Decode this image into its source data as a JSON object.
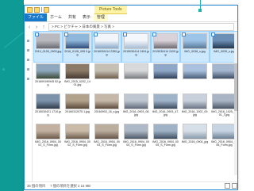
{
  "window": {
    "tools_badge": "Picture Tools",
    "title": "img"
  },
  "ribbon": {
    "tabs": [
      "ファイル",
      "ホーム",
      "共有",
      "表示",
      "管理"
    ]
  },
  "address": {
    "path": "> PC > ピクチャ > 日本の風景 > 写真 >"
  },
  "files": [
    {
      "name": "2019_0128_0903.jpg",
      "colors": [
        "#b9b9c0",
        "#6a6a72"
      ],
      "selected": true
    },
    {
      "name": "2016_0128_095 0.jpg",
      "colors": [
        "#8fb6db",
        "#2e4c79"
      ],
      "selected": true
    },
    {
      "name": "2016030414 2350.jpg",
      "colors": [
        "#f2f6fb",
        "#8aa9c8"
      ],
      "selected": true
    },
    {
      "name": "2015030414 2404.jpg",
      "colors": [
        "#f3f6fa",
        "#a7bcd4"
      ],
      "selected": true
    },
    {
      "name": "2015030414 2420.jpg",
      "colors": [
        "#d9d2d9",
        "#6e6a70"
      ],
      "selected": true
    },
    {
      "name": "IMG_0038_s.jpg",
      "colors": [
        "#9cc4e8",
        "#5a7896"
      ],
      "selected": true
    },
    {
      "name": "IMG_0039_s.jpg",
      "colors": [
        "#6c8fb5",
        "#22364f"
      ],
      "selected": true
    },
    {
      "name": "201609190945 52.jpg",
      "colors": [
        "#8fa8bd",
        "#3c4a38"
      ],
      "selected": false
    },
    {
      "name": "IMG_2015_0202_1401.jpg",
      "colors": [
        "#8b7a66",
        "#463a30"
      ],
      "selected": false
    },
    {
      "name": "",
      "colors": [
        "#c6c0b4",
        "#6f5f4c"
      ],
      "selected": false
    },
    {
      "name": "",
      "colors": [
        "#d8d9db",
        "#7a7c81"
      ],
      "selected": false
    },
    {
      "name": "",
      "colors": [
        "#90a8c8",
        "#30405a"
      ],
      "selected": false
    },
    {
      "name": "",
      "colors": [
        "#a9c1de",
        "#4c5e79"
      ],
      "selected": false
    },
    {
      "name": "",
      "colors": [
        "#a4b7cf",
        "#3e4d63"
      ],
      "selected": false
    },
    {
      "name": "2015030421 1710.jpg",
      "colors": [
        "#7d93ac",
        "#2e3c4a"
      ],
      "selected": false
    },
    {
      "name": "20160312075 1.jpg",
      "colors": [
        "#b2a28c",
        "#5a4a38"
      ],
      "selected": false
    },
    {
      "name": "20160903_16_s.jpg",
      "colors": [
        "#c5b8a8",
        "#5c4a3a"
      ],
      "selected": false
    },
    {
      "name": "IMG_2016_0903_08.jpg",
      "colors": [
        "#bfc7d2",
        "#5f6a7a"
      ],
      "selected": false
    },
    {
      "name": "IMG_2016_0903_47.jpg",
      "colors": [
        "#9fb3c9",
        "#3b4a5c"
      ],
      "selected": false
    },
    {
      "name": "IMG_2016_1002_09.jpg",
      "colors": [
        "#c8d0dc",
        "#6a7484"
      ],
      "selected": false
    },
    {
      "name": "IMG_2016_1025_1001_T.jpg",
      "colors": [
        "#a9b5c5",
        "#4a5666"
      ],
      "selected": false
    },
    {
      "name": "IMG_2016_0904_0001_S_Form.jpg",
      "colors": [
        "#c2b1a0",
        "#6b5a4a"
      ],
      "selected": false
    },
    {
      "name": "IMG_2016_0904_0002_S_Form.jpg",
      "colors": [
        "#cabaa8",
        "#6e5d4d"
      ],
      "selected": false
    },
    {
      "name": "IMG_2016_0904_0003_S_Form.jpg",
      "colors": [
        "#bcae9e",
        "#645548"
      ],
      "selected": false
    },
    {
      "name": "IMG_2016_0904_0004_S_Form.jpg",
      "colors": [
        "#aeb9c8",
        "#4e5968"
      ],
      "selected": false
    },
    {
      "name": "IMG_2016_0904_0005_S_Form.jpg",
      "colors": [
        "#9fb2c6",
        "#3f4e60"
      ],
      "selected": false
    },
    {
      "name": "IMG_2016_0904_jpg",
      "colors": [
        "#d7dfe8",
        "#8799ab"
      ],
      "selected": false
    },
    {
      "name": "IMG_2016_0904_0006_Form.jpg",
      "colors": [
        "#c7d4e2",
        "#6c7f94"
      ],
      "selected": false
    }
  ],
  "status": {
    "item_count": "36 個の項目",
    "selection": "7 個の項目を選択 2.16 MB"
  }
}
